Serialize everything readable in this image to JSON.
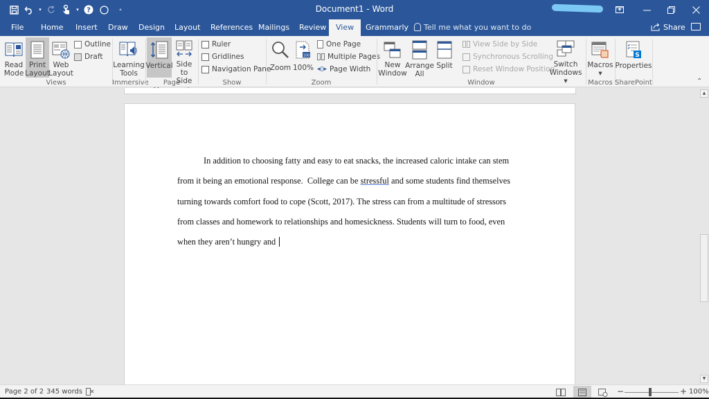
{
  "window": {
    "title": "Document1 - Word",
    "controls": [
      "ribbon-display-options",
      "minimize",
      "restore",
      "close"
    ]
  },
  "quick_access": {
    "items": [
      "save",
      "undo",
      "redo",
      "touch-mode",
      "help",
      "circle"
    ],
    "customize_label": "Customize Quick Access Toolbar"
  },
  "tabs": [
    {
      "label": "File"
    },
    {
      "label": "Home"
    },
    {
      "label": "Insert"
    },
    {
      "label": "Draw"
    },
    {
      "label": "Design"
    },
    {
      "label": "Layout"
    },
    {
      "label": "References"
    },
    {
      "label": "Mailings"
    },
    {
      "label": "Review"
    },
    {
      "label": "View",
      "active": true
    },
    {
      "label": "Grammarly"
    }
  ],
  "tell_me": "Tell me what you want to do",
  "share_label": "Share",
  "ribbon": {
    "views": {
      "label": "Views",
      "read_mode": "Read Mode",
      "read_mode_l1": "Read",
      "read_mode_l2": "Mode",
      "print_l1": "Print",
      "print_l2": "Layout",
      "web_l1": "Web",
      "web_l2": "Layout",
      "outline": "Outline",
      "draft": "Draft"
    },
    "immersive": {
      "label": "Immersive",
      "learning_l1": "Learning",
      "learning_l2": "Tools"
    },
    "page_movement": {
      "label": "Page Movement",
      "vertical": "Vertical",
      "side_l1": "Side",
      "side_l2": "to Side"
    },
    "show": {
      "label": "Show",
      "ruler": "Ruler",
      "gridlines": "Gridlines",
      "navigation_pane": "Navigation Pane",
      "ruler_checked": false,
      "gridlines_checked": false,
      "navigation_pane_checked": false
    },
    "zoom": {
      "label": "Zoom",
      "zoom": "Zoom",
      "hundred": "100%",
      "one_page": "One Page",
      "multiple_pages": "Multiple Pages",
      "page_width": "Page Width"
    },
    "window": {
      "label": "Window",
      "new_l1": "New",
      "new_l2": "Window",
      "arrange_l1": "Arrange",
      "arrange_l2": "All",
      "split": "Split",
      "view_side_by_side": "View Side by Side",
      "synchronous_scrolling": "Synchronous Scrolling",
      "reset_window_position": "Reset Window Position",
      "switch_l1": "Switch",
      "switch_l2": "Windows"
    },
    "macros": {
      "label": "Macros",
      "macros": "Macros"
    },
    "sharepoint": {
      "label": "SharePoint",
      "properties": "Properties"
    }
  },
  "document": {
    "lines": [
      "In addition to choosing fatty and easy to eat snacks, the increased caloric intake can stem",
      "from it being an emotional response.  College can be ",
      "turning towards comfort food to cope (Scott, 2017). The stress can from a multitude of stressors",
      "from classes and homework to relationships and homesickness. Students will turn to food, even",
      "when they aren’t hungry and "
    ],
    "misspelled_word": "stressful",
    "line2_after": " and some students find themselves"
  },
  "status": {
    "page": "Page 2 of 2",
    "words": "345 words",
    "zoom_percent": "100%",
    "zoom_value": 100
  },
  "scroll": {
    "position_fraction": 0.58
  }
}
